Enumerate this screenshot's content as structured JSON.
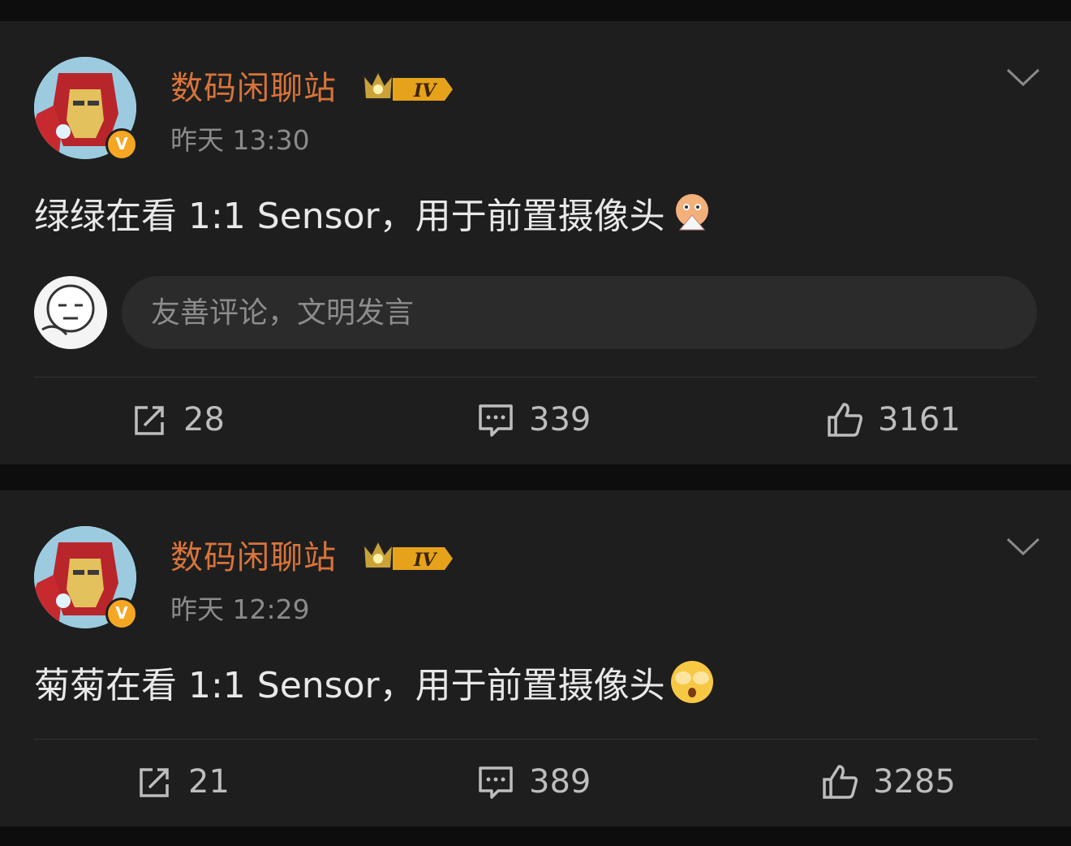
{
  "posts": [
    {
      "author": "数码闲聊站",
      "vip_level": "IV",
      "verified_badge": "V",
      "time": "昨天 13:30",
      "text": "绿绿在看 1:1 Sensor，用于前置摄像头",
      "emoji_icon": "fan-hiding-emoji",
      "comment_placeholder": "友善评论，文明发言",
      "reposts": "28",
      "comments": "339",
      "likes": "3161"
    },
    {
      "author": "数码闲聊站",
      "vip_level": "IV",
      "verified_badge": "V",
      "time": "昨天 12:29",
      "text": "菊菊在看 1:1 Sensor，用于前置摄像头",
      "emoji_icon": "cover-face-emoji",
      "reposts": "21",
      "comments": "389",
      "likes": "3285"
    }
  ],
  "colors": {
    "background": "#0d0d0d",
    "card": "#1e1e1e",
    "username": "#d8743a",
    "verified": "#f5a623",
    "muted": "#8a8a8a"
  }
}
